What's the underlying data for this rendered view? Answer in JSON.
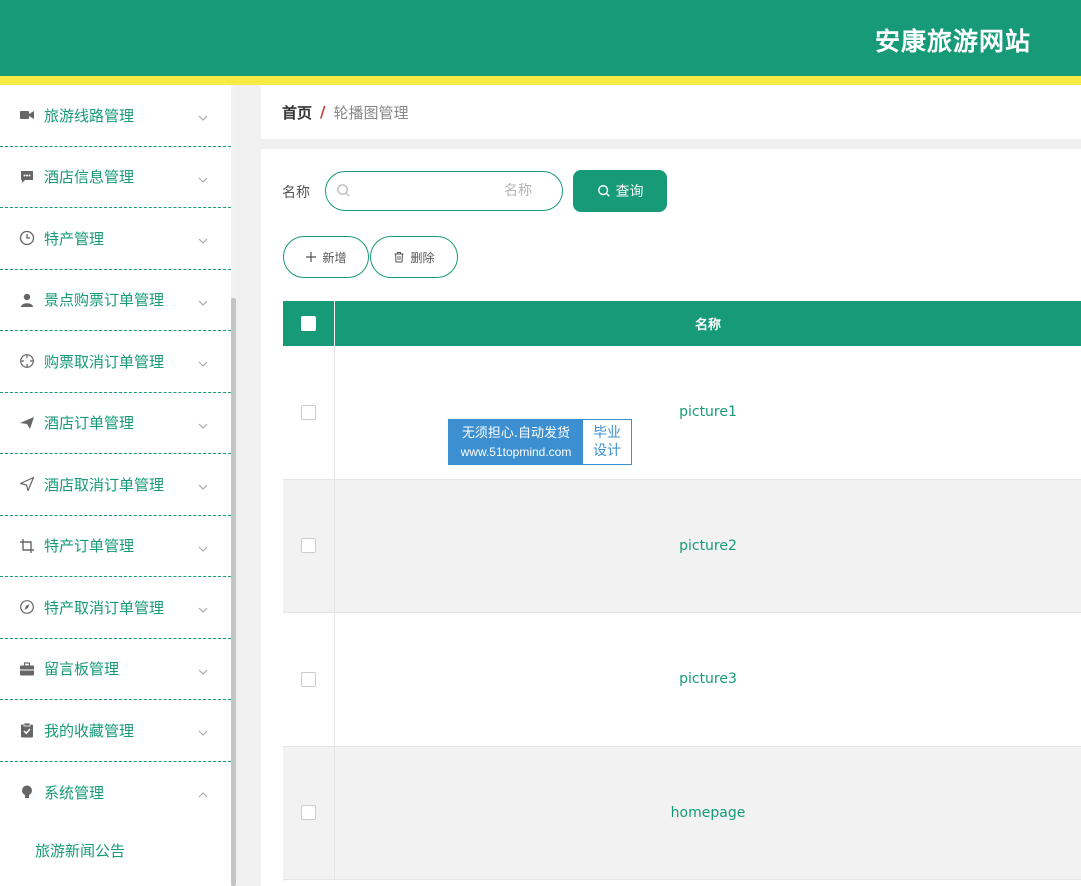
{
  "header": {
    "site_title": "安康旅游网站"
  },
  "sidebar": {
    "items": [
      {
        "label": "旅游线路管理",
        "icon": "video-camera-icon",
        "expanded": false
      },
      {
        "label": "酒店信息管理",
        "icon": "comment-icon",
        "expanded": false
      },
      {
        "label": "特产管理",
        "icon": "clock-icon",
        "expanded": false
      },
      {
        "label": "景点购票订单管理",
        "icon": "user-icon",
        "expanded": false
      },
      {
        "label": "购票取消订单管理",
        "icon": "crosshair-icon",
        "expanded": false
      },
      {
        "label": "酒店订单管理",
        "icon": "paper-plane-icon",
        "expanded": false
      },
      {
        "label": "酒店取消订单管理",
        "icon": "send-icon",
        "expanded": false
      },
      {
        "label": "特产订单管理",
        "icon": "crop-icon",
        "expanded": false
      },
      {
        "label": "特产取消订单管理",
        "icon": "compass-icon",
        "expanded": false
      },
      {
        "label": "留言板管理",
        "icon": "briefcase-icon",
        "expanded": false
      },
      {
        "label": "我的收藏管理",
        "icon": "clipboard-check-icon",
        "expanded": false
      },
      {
        "label": "系统管理",
        "icon": "lightbulb-icon",
        "expanded": true
      }
    ],
    "subitems": [
      {
        "label": "旅游新闻公告"
      }
    ]
  },
  "breadcrumb": {
    "home": "首页",
    "separator": "/",
    "current": "轮播图管理"
  },
  "search": {
    "label": "名称",
    "placeholder": "名称",
    "value": "",
    "button_label": "查询"
  },
  "actions": {
    "add_label": "新增",
    "delete_label": "删除"
  },
  "table": {
    "columns": [
      "名称"
    ],
    "rows": [
      {
        "name": "picture1"
      },
      {
        "name": "picture2"
      },
      {
        "name": "picture3"
      },
      {
        "name": "homepage"
      }
    ]
  },
  "watermark": {
    "line1": "无须担心.自动发货",
    "line2": "www.51topmind.com",
    "right_line1": "毕业",
    "right_line2": "设计"
  },
  "colors": {
    "primary": "#169a78",
    "header_stripe": "#f7ea45",
    "watermark_blue": "#3c8fd0"
  }
}
